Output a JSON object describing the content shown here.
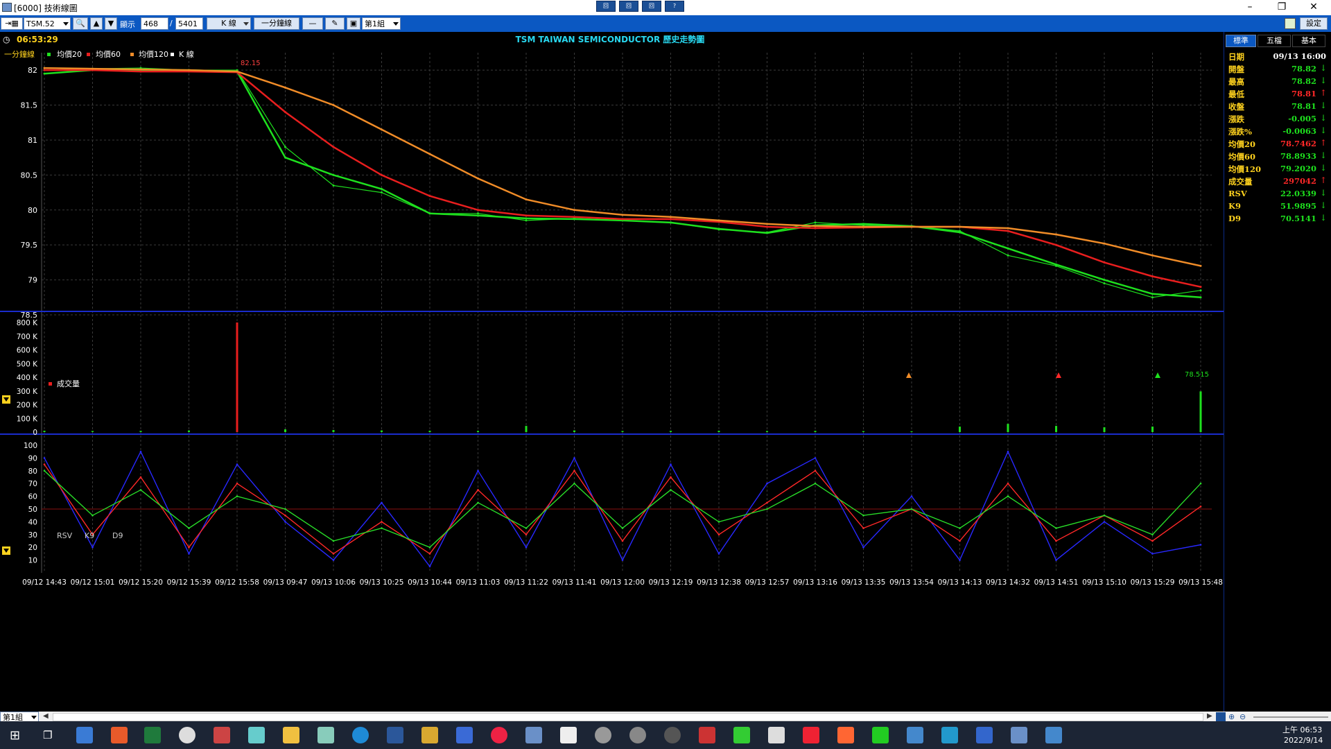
{
  "window": {
    "title": "[6000] 技術線圖",
    "toolbar_buttons": [
      "回",
      "回",
      "回",
      "?"
    ]
  },
  "toolbar": {
    "symbol": "TSM.52",
    "show_label": "顯示",
    "show_count": "468",
    "separator": "/",
    "total_count": "5401",
    "chart_type": "K 線",
    "interval": "一分鐘線",
    "line_style": "—",
    "draw_tool": "✎",
    "group": "第1組"
  },
  "header": {
    "time": "06:53:29",
    "title": "TSM TAIWAN SEMICONDUCTOR 歷史走勢圖"
  },
  "legend": {
    "interval": "一分鐘線",
    "ma20": "均價20",
    "ma60": "均價60",
    "ma120": "均價120",
    "k": "K 線"
  },
  "colors": {
    "ma20": "#1ee01e",
    "ma60": "#e81e1e",
    "ma120": "#f08c28",
    "price": "#1ee01e",
    "grid": "#3a3a3a",
    "rsv": "#2828ff",
    "k9": "#ff2828",
    "d9": "#28dc28",
    "accent": "#0b58c2"
  },
  "main_panel": {
    "high_label": "82.15",
    "low_label": "78.515",
    "y_ticks": [
      "82",
      "81.5",
      "81",
      "80.5",
      "80",
      "79.5",
      "79",
      "78.5"
    ]
  },
  "volume_panel": {
    "label": "成交量",
    "y_ticks": [
      "800 K",
      "700 K",
      "600 K",
      "500 K",
      "400 K",
      "300 K",
      "200 K",
      "100 K",
      "0"
    ]
  },
  "kd_panel": {
    "labels": [
      "RSV",
      "K9",
      "D9"
    ],
    "y_ticks": [
      "100",
      "90",
      "80",
      "70",
      "60",
      "50",
      "40",
      "30",
      "20",
      "10"
    ]
  },
  "x_ticks": [
    "09/12 14:43",
    "09/12 15:01",
    "09/12 15:20",
    "09/12 15:39",
    "09/12 15:58",
    "09/13 09:47",
    "09/13 10:06",
    "09/13 10:25",
    "09/13 10:44",
    "09/13 11:03",
    "09/13 11:22",
    "09/13 11:41",
    "09/13 12:00",
    "09/13 12:19",
    "09/13 12:38",
    "09/13 12:57",
    "09/13 13:16",
    "09/13 13:35",
    "09/13 13:54",
    "09/13 14:13",
    "09/13 14:32",
    "09/13 14:51",
    "09/13 15:10",
    "09/13 15:29",
    "09/13 15:48"
  ],
  "right_panel": {
    "tabs": [
      "標準",
      "五檔",
      "基本"
    ],
    "settings": "設定",
    "rows": [
      {
        "key": "日期",
        "value": "09/13 16:00",
        "color": "#ffffff",
        "arrow": ""
      },
      {
        "key": "開盤",
        "value": "78.82",
        "color": "#1ee01e",
        "arrow": "↓"
      },
      {
        "key": "最高",
        "value": "78.82",
        "color": "#1ee01e",
        "arrow": "↓"
      },
      {
        "key": "最低",
        "value": "78.81",
        "color": "#ff2828",
        "arrow": "↑"
      },
      {
        "key": "收盤",
        "value": "78.81",
        "color": "#1ee01e",
        "arrow": "↓"
      },
      {
        "key": "漲跌",
        "value": "-0.005",
        "color": "#1ee01e",
        "arrow": "↓"
      },
      {
        "key": "漲跌%",
        "value": "-0.0063",
        "color": "#1ee01e",
        "arrow": "↓"
      },
      {
        "key": "均價20",
        "value": "78.7462",
        "color": "#ff2828",
        "arrow": "↑"
      },
      {
        "key": "均價60",
        "value": "78.8933",
        "color": "#1ee01e",
        "arrow": "↓"
      },
      {
        "key": "均價120",
        "value": "79.2020",
        "color": "#1ee01e",
        "arrow": "↓"
      },
      {
        "key": "成交量",
        "value": "297042",
        "color": "#ff2828",
        "arrow": "↑"
      },
      {
        "key": "RSV",
        "value": "22.0339",
        "color": "#1ee01e",
        "arrow": "↓"
      },
      {
        "key": "K9",
        "value": "51.9895",
        "color": "#1ee01e",
        "arrow": "↓"
      },
      {
        "key": "D9",
        "value": "70.5141",
        "color": "#1ee01e",
        "arrow": "↓"
      }
    ]
  },
  "bottom": {
    "group": "第1組"
  },
  "taskbar": {
    "time": "上午 06:53",
    "date": "2022/9/14"
  },
  "chart_data": [
    {
      "type": "line",
      "title": "TSM TAIWAN SEMICONDUCTOR 歷史走勢圖",
      "ylim": [
        78.5,
        82.15
      ],
      "x": [
        "09/12 14:43",
        "09/12 15:01",
        "09/12 15:20",
        "09/12 15:39",
        "09/12 15:58",
        "09/13 09:47",
        "09/13 10:06",
        "09/13 10:25",
        "09/13 10:44",
        "09/13 11:03",
        "09/13 11:22",
        "09/13 11:41",
        "09/13 12:00",
        "09/13 12:19",
        "09/13 12:38",
        "09/13 12:57",
        "09/13 13:16",
        "09/13 13:35",
        "09/13 13:54",
        "09/13 14:13",
        "09/13 14:32",
        "09/13 14:51",
        "09/13 15:10",
        "09/13 15:29",
        "09/13 15:48"
      ],
      "series": [
        {
          "name": "K 線",
          "values": [
            82.0,
            82.02,
            82.03,
            82.0,
            82.0,
            80.9,
            80.35,
            80.25,
            79.95,
            79.95,
            79.85,
            79.88,
            79.85,
            79.82,
            79.72,
            79.68,
            79.82,
            79.78,
            79.77,
            79.7,
            79.35,
            79.2,
            78.95,
            78.75,
            78.85
          ]
        },
        {
          "name": "均價20",
          "values": [
            81.95,
            82.0,
            82.0,
            82.0,
            81.98,
            80.75,
            80.5,
            80.3,
            79.95,
            79.92,
            79.88,
            79.87,
            79.85,
            79.82,
            79.73,
            79.67,
            79.78,
            79.8,
            79.77,
            79.68,
            79.45,
            79.22,
            79.0,
            78.8,
            78.75
          ]
        },
        {
          "name": "均價60",
          "values": [
            82.0,
            82.0,
            81.98,
            81.98,
            81.97,
            81.4,
            80.9,
            80.5,
            80.2,
            80.0,
            79.92,
            79.9,
            79.87,
            79.87,
            79.83,
            79.76,
            79.74,
            79.75,
            79.76,
            79.76,
            79.7,
            79.5,
            79.25,
            79.05,
            78.9
          ]
        },
        {
          "name": "均價120",
          "values": [
            82.03,
            82.02,
            82.01,
            82.0,
            81.98,
            81.75,
            81.5,
            81.15,
            80.8,
            80.45,
            80.15,
            80.0,
            79.93,
            79.9,
            79.85,
            79.8,
            79.77,
            79.76,
            79.76,
            79.76,
            79.74,
            79.65,
            79.52,
            79.35,
            79.2
          ]
        }
      ]
    },
    {
      "type": "bar",
      "title": "成交量",
      "ylim": [
        0,
        800000
      ],
      "categories": [
        "09/12 14:43",
        "09/12 15:01",
        "09/12 15:20",
        "09/12 15:39",
        "09/12 15:58",
        "09/13 09:47",
        "09/13 10:06",
        "09/13 10:25",
        "09/13 10:44",
        "09/13 11:03",
        "09/13 11:22",
        "09/13 11:41",
        "09/13 12:00",
        "09/13 12:19",
        "09/13 12:38",
        "09/13 12:57",
        "09/13 13:16",
        "09/13 13:35",
        "09/13 13:54",
        "09/13 14:13",
        "09/13 14:32",
        "09/13 14:51",
        "09/13 15:10",
        "09/13 15:29",
        "09/13 15:48"
      ],
      "values": [
        10000,
        8000,
        9000,
        12000,
        800000,
        20000,
        15000,
        12000,
        10000,
        9000,
        45000,
        12000,
        8000,
        9000,
        10000,
        8000,
        9000,
        7000,
        6000,
        40000,
        60000,
        45000,
        35000,
        40000,
        297042
      ]
    },
    {
      "type": "line",
      "title": "RSV K9 D9",
      "ylim": [
        0,
        100
      ],
      "x": [
        "09/12 14:43",
        "09/12 15:01",
        "09/12 15:20",
        "09/12 15:39",
        "09/12 15:58",
        "09/13 09:47",
        "09/13 10:06",
        "09/13 10:25",
        "09/13 10:44",
        "09/13 11:03",
        "09/13 11:22",
        "09/13 11:41",
        "09/13 12:00",
        "09/13 12:19",
        "09/13 12:38",
        "09/13 12:57",
        "09/13 13:16",
        "09/13 13:35",
        "09/13 13:54",
        "09/13 14:13",
        "09/13 14:32",
        "09/13 14:51",
        "09/13 15:10",
        "09/13 15:29",
        "09/13 15:48"
      ],
      "series": [
        {
          "name": "RSV",
          "values": [
            90,
            20,
            95,
            15,
            85,
            40,
            10,
            55,
            5,
            80,
            20,
            90,
            10,
            85,
            15,
            70,
            90,
            20,
            60,
            10,
            95,
            10,
            40,
            15,
            22
          ]
        },
        {
          "name": "K9",
          "values": [
            85,
            30,
            75,
            20,
            70,
            45,
            15,
            40,
            15,
            65,
            30,
            80,
            25,
            75,
            30,
            55,
            80,
            35,
            50,
            25,
            70,
            25,
            45,
            25,
            52
          ]
        },
        {
          "name": "D9",
          "values": [
            80,
            45,
            65,
            35,
            60,
            50,
            25,
            35,
            20,
            55,
            35,
            70,
            35,
            65,
            40,
            50,
            70,
            45,
            50,
            35,
            60,
            35,
            45,
            30,
            70
          ]
        }
      ]
    }
  ]
}
